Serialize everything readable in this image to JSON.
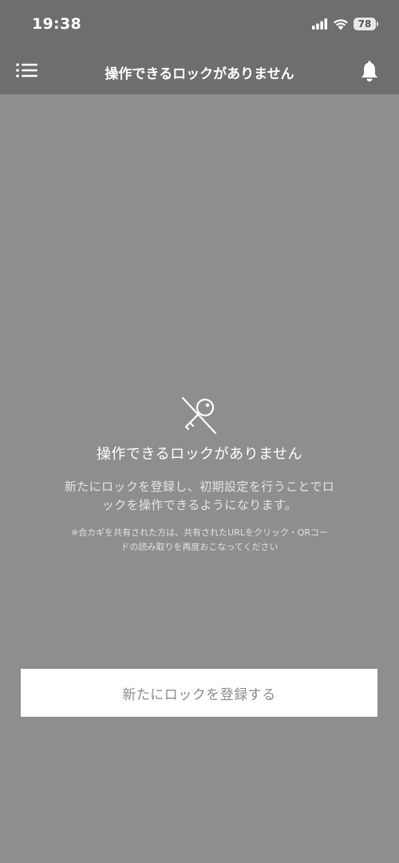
{
  "status_bar": {
    "time": "19:38",
    "battery": "78",
    "icons": [
      "signal-icon",
      "wifi-icon",
      "battery-icon"
    ]
  },
  "header": {
    "title": "操作できるロックがありません",
    "menu_icon": "hamburger-menu-icon",
    "notification_icon": "bell-icon"
  },
  "empty_state": {
    "icon": "key-crossed-icon",
    "title": "操作できるロックがありません",
    "description": "新たにロックを登録し、初期設定を行うことでロックを操作できるようになります。",
    "note": "※合カギを共有された方は、共有されたURLをクリック・QRコードの読み取りを再度おこなってください"
  },
  "actions": {
    "register_label": "新たにロックを登録する"
  },
  "colors": {
    "background": "#8e8e90",
    "header_background": "#6e6e70",
    "button_background": "#ffffff",
    "button_text": "#8a8a8c"
  }
}
